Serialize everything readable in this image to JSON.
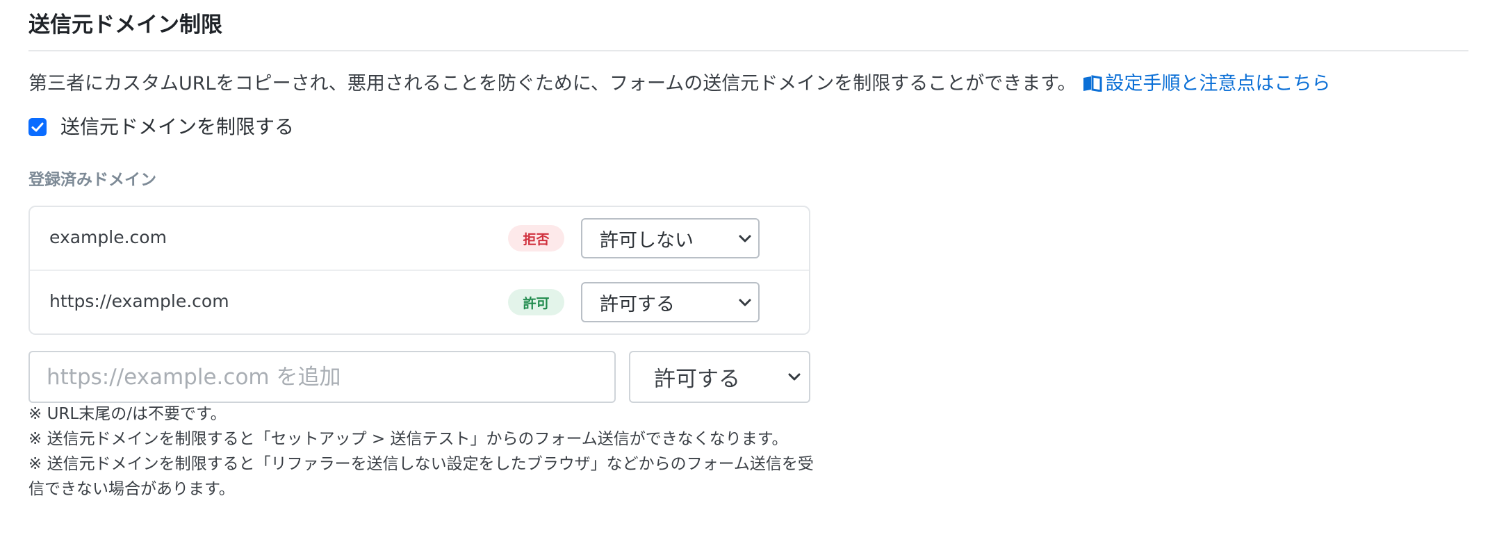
{
  "section": {
    "title": "送信元ドメイン制限"
  },
  "description": {
    "text": "第三者にカスタムURLをコピーされ、悪用されることを防ぐために、フォームの送信元ドメインを制限することができます。",
    "link_label": "設定手順と注意点はこちら",
    "link_icon": "book-icon",
    "link_color": "#0b6fd6"
  },
  "restrict": {
    "checked": true,
    "label": "送信元ドメインを制限する",
    "checkbox_color": "#0a6cff"
  },
  "registered": {
    "heading": "登録済みドメイン",
    "rows": [
      {
        "domain": "example.com",
        "badge": "拒否",
        "badge_type": "deny",
        "select_value": "許可しない"
      },
      {
        "domain": "https://example.com",
        "badge": "許可",
        "badge_type": "allow",
        "select_value": "許可する"
      }
    ]
  },
  "add": {
    "placeholder": "https://example.com を追加",
    "value": "",
    "select_value": "許可する"
  },
  "notes": [
    "※ URL末尾の/は不要です。",
    "※ 送信元ドメインを制限すると「セットアップ > 送信テスト」からのフォーム送信ができなくなります。",
    "※ 送信元ドメインを制限すると「リファラーを送信しない設定をしたブラウザ」などからのフォーム送信を受信できない場合があります。"
  ]
}
